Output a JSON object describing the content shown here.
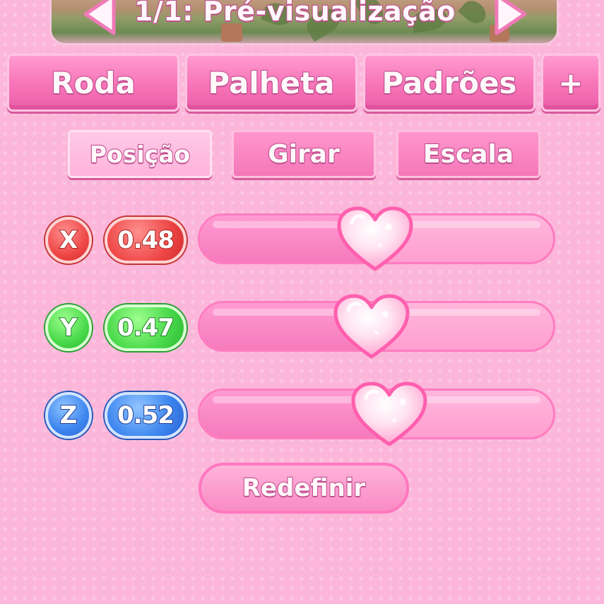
{
  "header": {
    "title": "1/1: Pré-visualização"
  },
  "tabs": {
    "wheel": "Roda",
    "palette": "Palheta",
    "patterns": "Padrões",
    "more": "+"
  },
  "subtabs": {
    "position": "Posição",
    "rotate": "Girar",
    "scale": "Escala",
    "active": "position"
  },
  "axes": [
    {
      "axis": "X",
      "value_label": "0.48",
      "value": 0.48,
      "color": "#ef4747"
    },
    {
      "axis": "Y",
      "value_label": "0.47",
      "value": 0.47,
      "color": "#49d94a"
    },
    {
      "axis": "Z",
      "value_label": "0.52",
      "value": 0.52,
      "color": "#3d86ef"
    }
  ],
  "reset_label": "Redefinir",
  "icons": {
    "prev": "arrow-left-icon",
    "next": "arrow-right-icon",
    "slider_handle": "heart-icon"
  },
  "colors": {
    "panel": "#fbb6da",
    "tab": "#f774b8",
    "text_outline": "#c04f8e"
  }
}
